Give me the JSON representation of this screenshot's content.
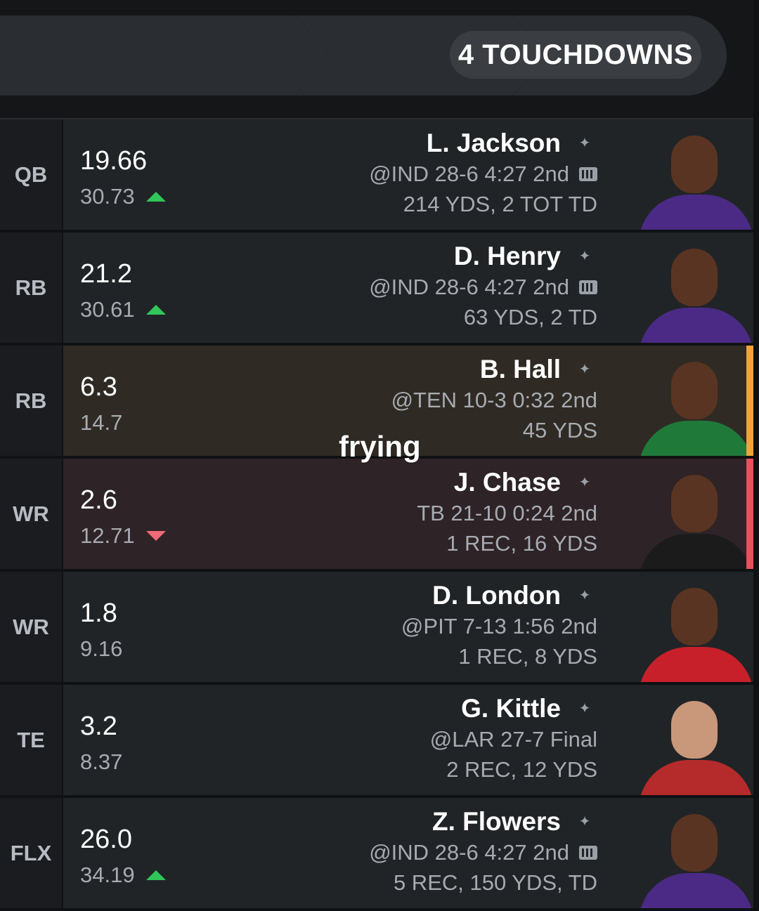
{
  "banner": {
    "label": "4 TOUCHDOWNS"
  },
  "overlay_caption": "frying",
  "roster": [
    {
      "pos": "QB",
      "score": "19.66",
      "proj": "30.73",
      "trend": "up",
      "name": "L. Jackson",
      "team_icon": "ravens-icon",
      "game": "@IND 28-6 4:27 2nd",
      "on_tv": true,
      "stats": "214 YDS, 2 TOT TD",
      "status": "normal",
      "jersey": "#4b2a86"
    },
    {
      "pos": "RB",
      "score": "21.2",
      "proj": "30.61",
      "trend": "up",
      "name": "D. Henry",
      "team_icon": "ravens-icon",
      "game": "@IND 28-6 4:27 2nd",
      "on_tv": true,
      "stats": "63 YDS, 2 TD",
      "status": "normal",
      "jersey": "#4b2a86"
    },
    {
      "pos": "RB",
      "score": "6.3",
      "proj": "14.7",
      "trend": "none",
      "name": "B. Hall",
      "team_icon": "jets-icon",
      "game": "@TEN 10-3 0:32 2nd",
      "on_tv": false,
      "stats": "45 YDS",
      "status": "warning",
      "jersey": "#1f7a3a",
      "flag": "#f0a33a"
    },
    {
      "pos": "WR",
      "score": "2.6",
      "proj": "12.71",
      "trend": "down",
      "name": "J. Chase",
      "team_icon": "bengals-icon",
      "game": "TB 21-10 0:24 2nd",
      "on_tv": false,
      "stats": "1 REC, 16 YDS",
      "status": "bad",
      "jersey": "#1b1b1b",
      "flag": "#e8505b"
    },
    {
      "pos": "WR",
      "score": "1.8",
      "proj": "9.16",
      "trend": "none",
      "name": "D. London",
      "team_icon": "falcons-icon",
      "game": "@PIT 7-13 1:56 2nd",
      "on_tv": false,
      "stats": "1 REC, 8 YDS",
      "status": "normal",
      "jersey": "#c8202a"
    },
    {
      "pos": "TE",
      "score": "3.2",
      "proj": "8.37",
      "trend": "none",
      "name": "G. Kittle",
      "team_icon": "49ers-icon",
      "game": "@LAR 27-7 Final",
      "on_tv": false,
      "stats": "2 REC, 12 YDS",
      "status": "normal",
      "jersey": "#b52b2b"
    },
    {
      "pos": "FLX",
      "score": "26.0",
      "proj": "34.19",
      "trend": "up",
      "name": "Z. Flowers",
      "team_icon": "ravens-icon",
      "game": "@IND 28-6 4:27 2nd",
      "on_tv": true,
      "stats": "5 REC, 150 YDS, TD",
      "status": "normal",
      "jersey": "#4b2a86"
    }
  ]
}
